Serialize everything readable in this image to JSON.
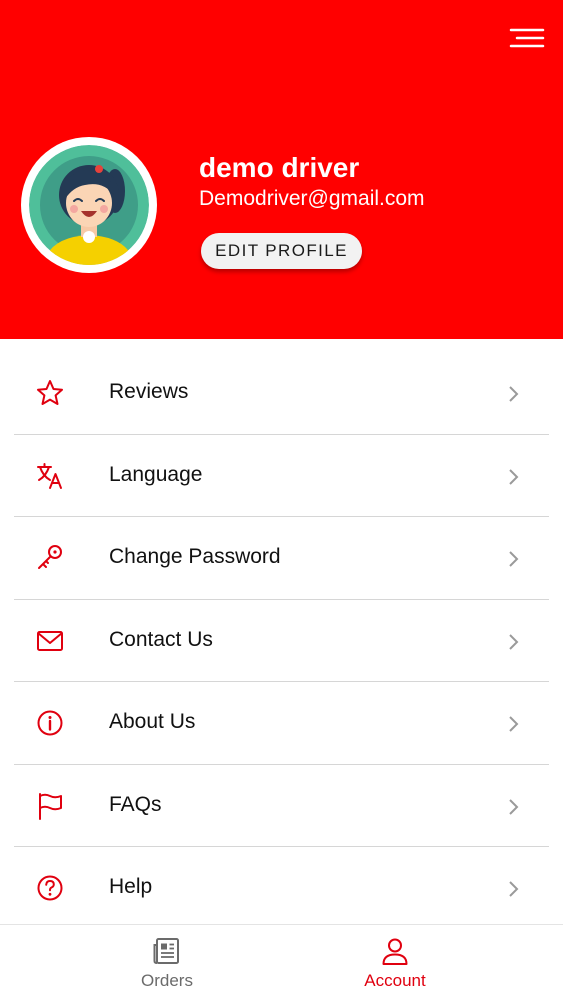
{
  "colors": {
    "accent": "#ff0000",
    "icon": "#e0000f",
    "inactive": "#6b6b6b",
    "divider": "#d6d6d6"
  },
  "header": {
    "menu_icon": "hamburger-menu-icon",
    "avatar_icon": "cartoon-girl-avatar",
    "name": "demo driver",
    "email": "Demodriver@gmail.com",
    "edit_profile_label": "EDIT PROFILE"
  },
  "menu": {
    "items": [
      {
        "label": "Reviews",
        "icon": "star-icon"
      },
      {
        "label": "Language",
        "icon": "translate-icon"
      },
      {
        "label": "Change Password",
        "icon": "key-icon"
      },
      {
        "label": "Contact Us",
        "icon": "mail-icon"
      },
      {
        "label": "About Us",
        "icon": "info-icon"
      },
      {
        "label": "FAQs",
        "icon": "flag-icon"
      },
      {
        "label": "Help",
        "icon": "help-icon"
      }
    ]
  },
  "bottom_nav": {
    "tabs": [
      {
        "label": "Orders",
        "icon": "newspaper-icon",
        "active": false
      },
      {
        "label": "Account",
        "icon": "person-icon",
        "active": true
      }
    ]
  }
}
